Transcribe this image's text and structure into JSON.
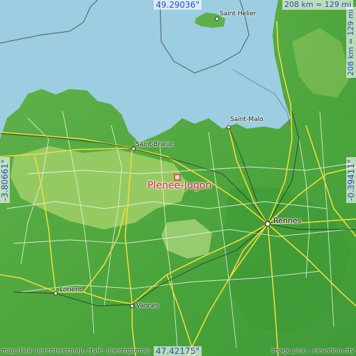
{
  "map": {
    "coordinates": {
      "north": "49.29036°",
      "south": "47.42175°",
      "west": "-3.80661°",
      "east": "-0.39411°"
    },
    "scale": {
      "horizontal": "208 km = 129 mi",
      "vertical": "208 km = 129 mi"
    },
    "place": {
      "name": "Plenee-Jugon",
      "marker_color": "#e0322f"
    },
    "cities": [
      {
        "id": "saint-helier",
        "name": "Saint Helier"
      },
      {
        "id": "saint-malo",
        "name": "Saint-Malo"
      },
      {
        "id": "saint-brieuc",
        "name": "Saint-Brieuc"
      },
      {
        "id": "rennes",
        "name": "Rennes"
      },
      {
        "id": "lorient",
        "name": "Lorient"
      },
      {
        "id": "vannes",
        "name": "Vannes"
      }
    ],
    "credits": {
      "left": "map data: openstreetmap, style: opentopomap",
      "right": "image proc.: elevation.city"
    },
    "colors": {
      "sea": "#9ccde0",
      "lowland": "#4eaa3e",
      "upland": "#a3cf68",
      "road": "#f2e24a",
      "coordinate_text": "#2a4bd6"
    }
  }
}
